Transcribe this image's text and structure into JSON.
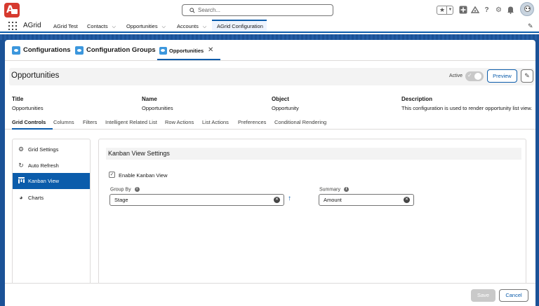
{
  "header": {
    "search_placeholder": "Search...",
    "icons": [
      "app-logo-icon",
      "search-icon",
      "favorite-star-icon",
      "chevron-down-icon",
      "add-icon",
      "trailhead-icon",
      "help-icon",
      "setup-gear-icon",
      "notifications-bell-icon",
      "avatar"
    ]
  },
  "appnav": {
    "app_name": "AGrid",
    "items": [
      {
        "label": "AGrid Test",
        "has_menu": false
      },
      {
        "label": "Contacts",
        "has_menu": true
      },
      {
        "label": "Opportunities",
        "has_menu": true
      },
      {
        "label": "Accounts",
        "has_menu": true
      }
    ],
    "active_item": "AGrid Configuration"
  },
  "workspace_tabs": {
    "tabs": [
      {
        "label": "Configurations"
      },
      {
        "label": "Configuration Groups"
      }
    ],
    "active_tab": "Opportunities"
  },
  "record": {
    "title": "Opportunities",
    "active_label": "Active",
    "preview_label": "Preview",
    "fields": [
      {
        "label": "Title",
        "value": "Opportunities"
      },
      {
        "label": "Name",
        "value": "Opportunities"
      },
      {
        "label": "Object",
        "value": "Opportunity"
      },
      {
        "label": "Description",
        "value": "This configuration is used to render opportunity list view."
      }
    ]
  },
  "subtabs": [
    "Grid Controls",
    "Columns",
    "Filters",
    "Intelligent Related List",
    "Row Actions",
    "List Actions",
    "Preferences",
    "Conditional Rendering"
  ],
  "leftnav": [
    {
      "label": "Grid Settings",
      "icon": "gear-icon"
    },
    {
      "label": "Auto Refresh",
      "icon": "refresh-icon"
    },
    {
      "label": "Kanban View",
      "icon": "kanban-icon"
    },
    {
      "label": "Charts",
      "icon": "pie-chart-icon"
    }
  ],
  "kanban": {
    "section_title": "Kanban View Settings",
    "enable_label": "Enable Kanban View",
    "enable_checked": true,
    "group_by_label": "Group By",
    "group_by_value": "Stage",
    "summary_label": "Summary",
    "summary_value": "Amount"
  },
  "footer": {
    "save_label": "Save",
    "cancel_label": "Cancel"
  },
  "colors": {
    "brand_blue": "#0b5cab",
    "logo_red": "#d63a2f",
    "background_band": "#1b5297"
  }
}
